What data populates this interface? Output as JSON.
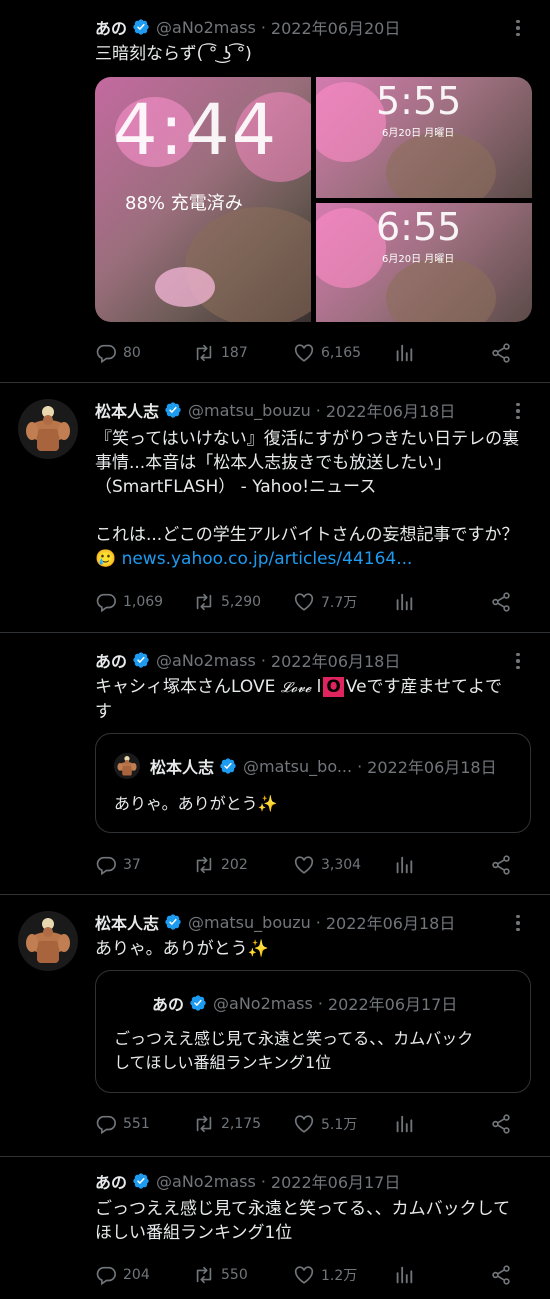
{
  "colors": {
    "bg": "#000000",
    "text": "#e7e9ea",
    "muted": "#71767b",
    "link": "#1d9bf0",
    "verified": "#1d9bf0",
    "border": "#2f3336"
  },
  "icons": {
    "reply": "reply-icon",
    "retweet": "retweet-icon",
    "like": "heart-icon",
    "stats": "stats-icon",
    "share": "share-icon",
    "verified": "verified-badge-icon",
    "more": "more-icon"
  },
  "tweets": [
    {
      "name": "あの",
      "handle": "@aNo2mass",
      "date": "2022年06月20日",
      "text": "三暗刻ならず( ͡° ͜ʖ ͡°)",
      "media": {
        "big_time": "4:44",
        "big_status": "88% 充電済み",
        "small1_time": "5:55",
        "small1_date": "6月20日 月曜日",
        "small2_time": "6:55",
        "small2_date": "6月20日 月曜日"
      },
      "replies": "80",
      "retweets": "187",
      "likes": "6,165"
    },
    {
      "name": "松本人志",
      "handle": "@matsu_bouzu",
      "date": "2022年06月18日",
      "text_line1": "『笑ってはいけない』復活にすがりつきたい日テレの裏",
      "text_line2": "事情...本音は「松本人志抜きでも放送したい」",
      "text_line3": "（SmartFLASH） - Yahoo!ニュース",
      "text_line4": "これは...どこの学生アルバイトさんの妄想記事ですか？",
      "emoji": "🥲",
      "link": "news.yahoo.co.jp/articles/44164...",
      "replies": "1,069",
      "retweets": "5,290",
      "likes": "7.7万"
    },
    {
      "name": "あの",
      "handle": "@aNo2mass",
      "date": "2022年06月18日",
      "text_line1a": "キャシィ塚本さんLOVE ",
      "text_line1b": "𝓛𝓸𝓿𝓮",
      "text_line1c": " l",
      "text_line1d": "O",
      "text_line1e": "Veです産ませてよで",
      "text_line2": "す",
      "quote": {
        "name": "松本人志",
        "handle": "@matsu_bo...",
        "date": "2022年06月18日",
        "text": "ありゃ。ありがとう✨"
      },
      "replies": "37",
      "retweets": "202",
      "likes": "3,304"
    },
    {
      "name": "松本人志",
      "handle": "@matsu_bouzu",
      "date": "2022年06月18日",
      "text": "ありゃ。ありがとう✨",
      "quote": {
        "name": "あの",
        "handle": "@aNo2mass",
        "date": "2022年06月17日",
        "text_line1": "ごっつええ感じ見て永遠と笑ってる、、カムバック",
        "text_line2": "してほしい番組ランキング1位"
      },
      "replies": "551",
      "retweets": "2,175",
      "likes": "5.1万"
    },
    {
      "name": "あの",
      "handle": "@aNo2mass",
      "date": "2022年06月17日",
      "text_line1": "ごっつええ感じ見て永遠と笑ってる、、カムバックして",
      "text_line2": "ほしい番組ランキング1位",
      "replies": "204",
      "retweets": "550",
      "likes": "1.2万"
    }
  ]
}
